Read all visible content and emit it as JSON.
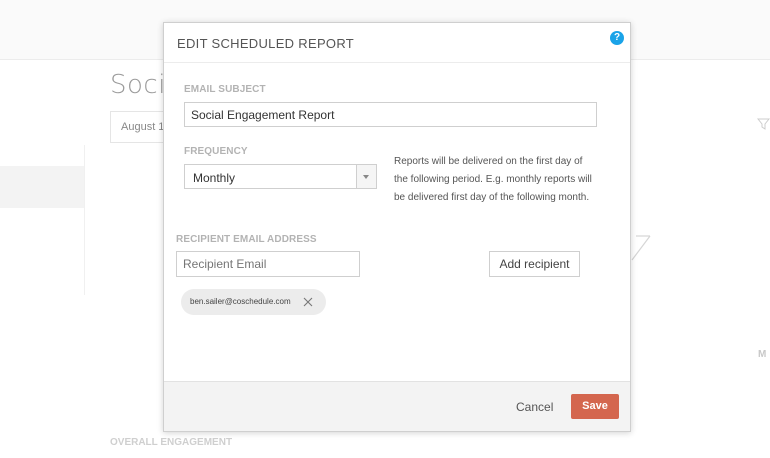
{
  "background": {
    "page_title": "Social",
    "date_value": "August 1",
    "side_label": "M",
    "section_label": "OVERALL ENGAGEMENT"
  },
  "modal": {
    "title": "EDIT SCHEDULED REPORT",
    "help_icon_glyph": "?",
    "email_subject": {
      "label": "EMAIL SUBJECT",
      "value": "Social Engagement Report"
    },
    "frequency": {
      "label": "FREQUENCY",
      "selected": "Monthly",
      "help_text": "Reports will be delivered on the first day of the following period. E.g. monthly reports will be delivered first day of the following month."
    },
    "recipient": {
      "label": "RECIPIENT EMAIL ADDRESS",
      "placeholder": "Recipient Email",
      "add_button": "Add recipient",
      "recipients": [
        "ben.sailer@coschedule.com"
      ]
    },
    "footer": {
      "cancel": "Cancel",
      "save": "Save"
    }
  },
  "colors": {
    "accent_save": "#d4664e",
    "help_blue": "#1aa3e8"
  }
}
